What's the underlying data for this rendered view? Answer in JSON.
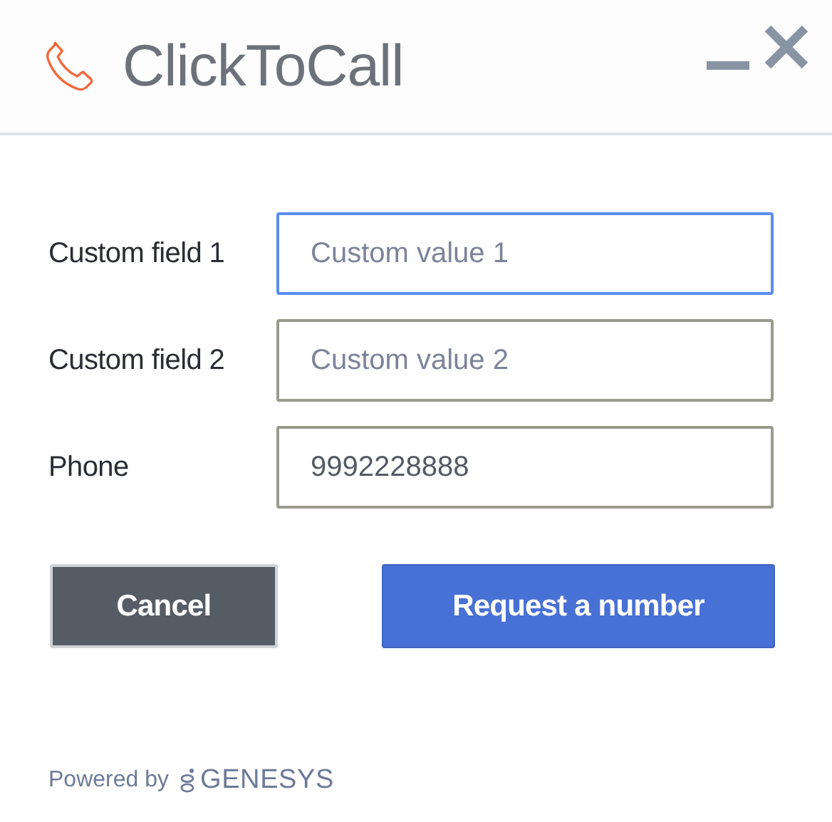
{
  "window": {
    "title": "ClickToCall"
  },
  "fields": [
    {
      "label": "Custom field 1",
      "placeholder": "Custom value 1",
      "focused": true
    },
    {
      "label": "Custom field 2",
      "placeholder": "Custom value 2",
      "focused": false
    },
    {
      "label": "Phone",
      "value": "9992228888",
      "focused": false
    }
  ],
  "buttons": [
    {
      "label": "Cancel",
      "kind": "secondary"
    },
    {
      "label": "Request a number",
      "kind": "primary"
    }
  ],
  "footer": {
    "powered_by": "Powered by",
    "brand": "GENESYS"
  }
}
